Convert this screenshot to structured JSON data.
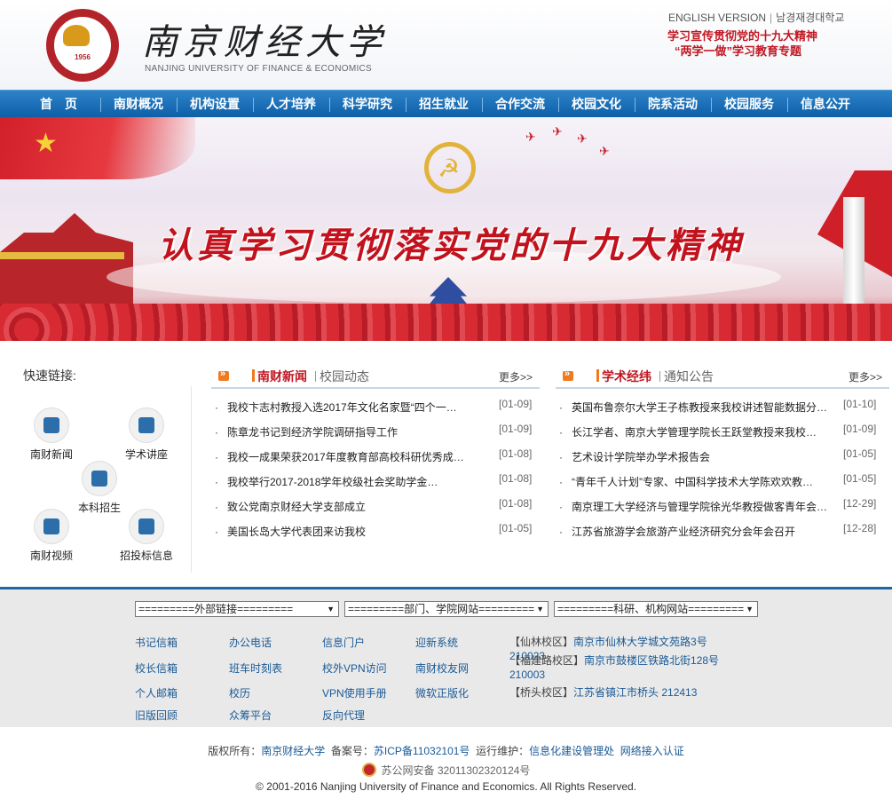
{
  "header": {
    "logo_name": "南京财经大学",
    "logo_en": "NANJING UNIVERSITY OF FINANCE & ECONOMICS",
    "logo_year": "1956",
    "english_version": "ENGLISH VERSION",
    "korean_version": "남경재경대학교",
    "promo1": "学习宣传贯彻党的十九大精神",
    "promo2": "“两学一做”学习教育专题"
  },
  "nav": [
    "首　页",
    "南财概况",
    "机构设置",
    "人才培养",
    "科学研究",
    "招生就业",
    "合作交流",
    "校园文化",
    "院系活动",
    "校园服务",
    "信息公开"
  ],
  "banner": {
    "title": "认真学习贯彻落实党的十九大精神"
  },
  "quick_links": {
    "title": "快速链接:",
    "items": [
      "南财新闻",
      "学术讲座",
      "本科招生",
      "南财视频",
      "招投标信息"
    ]
  },
  "news_panel": {
    "tab_active": "南财新闻",
    "tab_other": "校园动态",
    "more": "更多>>",
    "items": [
      {
        "title": "我校卞志村教授入选2017年文化名家暨“四个一…",
        "date": "[01-09]"
      },
      {
        "title": "陈章龙书记到经济学院调研指导工作",
        "date": "[01-09]"
      },
      {
        "title": "我校一成果荣获2017年度教育部高校科研优秀成…",
        "date": "[01-08]"
      },
      {
        "title": "我校举行2017-2018学年校级社会奖助学金…",
        "date": "[01-08]"
      },
      {
        "title": "致公党南京财经大学支部成立",
        "date": "[01-08]"
      },
      {
        "title": "美国长岛大学代表团来访我校",
        "date": "[01-05]"
      }
    ]
  },
  "academic_panel": {
    "tab_active": "学术经纬",
    "tab_other": "通知公告",
    "more": "更多>>",
    "items": [
      {
        "title": "英国布鲁奈尔大学王子栋教授来我校讲述智能数据分…",
        "date": "[01-10]"
      },
      {
        "title": "长江学者、南京大学管理学院长王跃堂教授来我校…",
        "date": "[01-09]"
      },
      {
        "title": "艺术设计学院举办学术报告会",
        "date": "[01-05]"
      },
      {
        "title": "“青年千人计划”专家、中国科学技术大学陈欢欢教…",
        "date": "[01-05]"
      },
      {
        "title": "南京理工大学经济与管理学院徐光华教授做客青年会…",
        "date": "[12-29]"
      },
      {
        "title": "江苏省旅游学会旅游产业经济研究分会年会召开",
        "date": "[12-28]"
      }
    ]
  },
  "selects": [
    "=========外部链接=========",
    "=========部门、学院网站=========",
    "=========科研、机构网站========="
  ],
  "footer_links": [
    [
      "书记信箱",
      "办公电话",
      "信息门户",
      "迎新系统"
    ],
    [
      "校长信箱",
      "班车时刻表",
      "校外VPN访问",
      "南财校友网"
    ],
    [
      "个人邮箱",
      "校历",
      "VPN使用手册",
      "微软正版化"
    ],
    [
      "旧版回顾",
      "众筹平台",
      "反向代理"
    ]
  ],
  "campuses": [
    {
      "name": "【仙林校区】",
      "addr": "南京市仙林大学城文苑路3号 210023"
    },
    {
      "name": "【福建路校区】",
      "addr": "南京市鼓楼区铁路北街128号 210003"
    },
    {
      "name": "【桥头校区】",
      "addr": "江苏省镇江市桥头 212413"
    }
  ],
  "copyright": {
    "owner_label": "版权所有：",
    "owner": "南京财经大学",
    "icp_label": "备案号：",
    "icp": "苏ICP备11032101号",
    "ops_label": "运行维护：",
    "ops": "信息化建设管理处",
    "network": "网络接入认证",
    "police": "苏公网安备 32011302320124号",
    "rights": "© 2001-2016 Nanjing University of Finance and Economics. All Rights Reserved."
  },
  "colors": {
    "nav_blue": "#0d5fa8",
    "brand_red": "#c01822",
    "link_blue": "#1a5a96"
  }
}
